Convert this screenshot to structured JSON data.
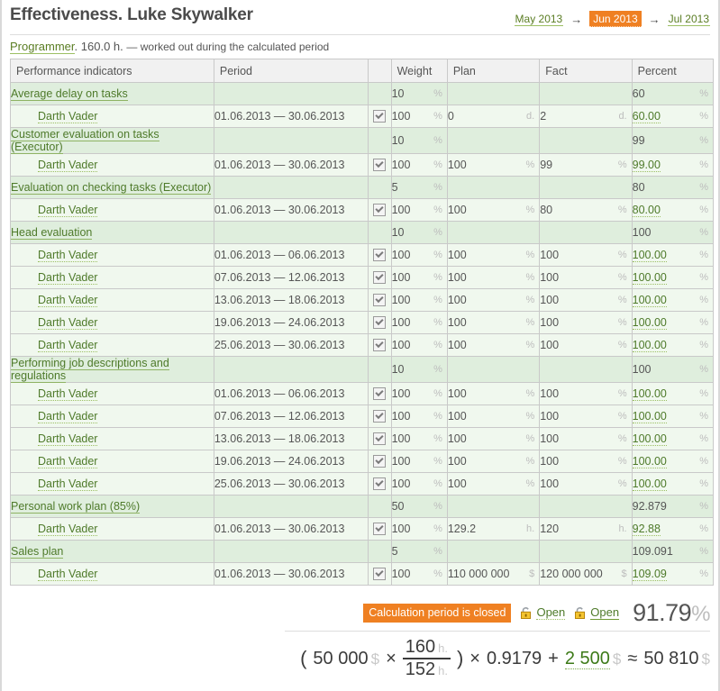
{
  "header": {
    "title": "Effectiveness. Luke Skywalker",
    "period_nav": [
      {
        "label": "May 2013",
        "current": false
      },
      {
        "label": "Jun 2013",
        "current": true
      },
      {
        "label": "Jul 2013",
        "current": false
      }
    ],
    "arrow": "→"
  },
  "subtitle": {
    "role": "Programmer",
    "role_suffix": ".",
    "hours": "160.0 h.",
    "note": "— worked out during the calculated period"
  },
  "table": {
    "columns": [
      "Performance indicators",
      "Period",
      "",
      "Weight",
      "Plan",
      "Fact",
      "Percent"
    ],
    "rows": [
      {
        "type": "group",
        "indicator": "Average delay on tasks",
        "period": "",
        "weight": "10",
        "weight_unit": "%",
        "plan": "",
        "plan_unit": "",
        "fact": "",
        "fact_unit": "",
        "percent": "60",
        "percent_unit": "%"
      },
      {
        "type": "item",
        "indicator": "Darth Vader",
        "period": "01.06.2013 — 30.06.2013",
        "checked": true,
        "weight": "100",
        "weight_unit": "%",
        "plan": "0",
        "plan_unit": "d.",
        "fact": "2",
        "fact_unit": "d.",
        "percent": "60.00",
        "percent_unit": "%"
      },
      {
        "type": "group",
        "indicator": "Customer evaluation on tasks (Executor)",
        "period": "",
        "weight": "10",
        "weight_unit": "%",
        "plan": "",
        "plan_unit": "",
        "fact": "",
        "fact_unit": "",
        "percent": "99",
        "percent_unit": "%"
      },
      {
        "type": "item",
        "indicator": "Darth Vader",
        "period": "01.06.2013 — 30.06.2013",
        "checked": true,
        "weight": "100",
        "weight_unit": "%",
        "plan": "100",
        "plan_unit": "%",
        "fact": "99",
        "fact_unit": "%",
        "percent": "99.00",
        "percent_unit": "%"
      },
      {
        "type": "group",
        "indicator": "Evaluation on checking tasks (Executor)",
        "period": "",
        "weight": "5",
        "weight_unit": "%",
        "plan": "",
        "plan_unit": "",
        "fact": "",
        "fact_unit": "",
        "percent": "80",
        "percent_unit": "%"
      },
      {
        "type": "item",
        "indicator": "Darth Vader",
        "period": "01.06.2013 — 30.06.2013",
        "checked": true,
        "weight": "100",
        "weight_unit": "%",
        "plan": "100",
        "plan_unit": "%",
        "fact": "80",
        "fact_unit": "%",
        "percent": "80.00",
        "percent_unit": "%"
      },
      {
        "type": "group",
        "indicator": "Head evaluation",
        "period": "",
        "weight": "10",
        "weight_unit": "%",
        "plan": "",
        "plan_unit": "",
        "fact": "",
        "fact_unit": "",
        "percent": "100",
        "percent_unit": "%"
      },
      {
        "type": "item",
        "indicator": "Darth Vader",
        "period": "01.06.2013 — 06.06.2013",
        "checked": true,
        "weight": "100",
        "weight_unit": "%",
        "plan": "100",
        "plan_unit": "%",
        "fact": "100",
        "fact_unit": "%",
        "percent": "100.00",
        "percent_unit": "%"
      },
      {
        "type": "item",
        "indicator": "Darth Vader",
        "period": "07.06.2013 — 12.06.2013",
        "checked": true,
        "weight": "100",
        "weight_unit": "%",
        "plan": "100",
        "plan_unit": "%",
        "fact": "100",
        "fact_unit": "%",
        "percent": "100.00",
        "percent_unit": "%"
      },
      {
        "type": "item",
        "indicator": "Darth Vader",
        "period": "13.06.2013 — 18.06.2013",
        "checked": true,
        "weight": "100",
        "weight_unit": "%",
        "plan": "100",
        "plan_unit": "%",
        "fact": "100",
        "fact_unit": "%",
        "percent": "100.00",
        "percent_unit": "%"
      },
      {
        "type": "item",
        "indicator": "Darth Vader",
        "period": "19.06.2013 — 24.06.2013",
        "checked": true,
        "weight": "100",
        "weight_unit": "%",
        "plan": "100",
        "plan_unit": "%",
        "fact": "100",
        "fact_unit": "%",
        "percent": "100.00",
        "percent_unit": "%"
      },
      {
        "type": "item",
        "indicator": "Darth Vader",
        "period": "25.06.2013 — 30.06.2013",
        "checked": true,
        "weight": "100",
        "weight_unit": "%",
        "plan": "100",
        "plan_unit": "%",
        "fact": "100",
        "fact_unit": "%",
        "percent": "100.00",
        "percent_unit": "%"
      },
      {
        "type": "group",
        "indicator": "Performing job descriptions and regulations",
        "period": "",
        "weight": "10",
        "weight_unit": "%",
        "plan": "",
        "plan_unit": "",
        "fact": "",
        "fact_unit": "",
        "percent": "100",
        "percent_unit": "%"
      },
      {
        "type": "item",
        "indicator": "Darth Vader",
        "period": "01.06.2013 — 06.06.2013",
        "checked": true,
        "weight": "100",
        "weight_unit": "%",
        "plan": "100",
        "plan_unit": "%",
        "fact": "100",
        "fact_unit": "%",
        "percent": "100.00",
        "percent_unit": "%"
      },
      {
        "type": "item",
        "indicator": "Darth Vader",
        "period": "07.06.2013 — 12.06.2013",
        "checked": true,
        "weight": "100",
        "weight_unit": "%",
        "plan": "100",
        "plan_unit": "%",
        "fact": "100",
        "fact_unit": "%",
        "percent": "100.00",
        "percent_unit": "%"
      },
      {
        "type": "item",
        "indicator": "Darth Vader",
        "period": "13.06.2013 — 18.06.2013",
        "checked": true,
        "weight": "100",
        "weight_unit": "%",
        "plan": "100",
        "plan_unit": "%",
        "fact": "100",
        "fact_unit": "%",
        "percent": "100.00",
        "percent_unit": "%"
      },
      {
        "type": "item",
        "indicator": "Darth Vader",
        "period": "19.06.2013 — 24.06.2013",
        "checked": true,
        "weight": "100",
        "weight_unit": "%",
        "plan": "100",
        "plan_unit": "%",
        "fact": "100",
        "fact_unit": "%",
        "percent": "100.00",
        "percent_unit": "%"
      },
      {
        "type": "item",
        "indicator": "Darth Vader",
        "period": "25.06.2013 — 30.06.2013",
        "checked": true,
        "weight": "100",
        "weight_unit": "%",
        "plan": "100",
        "plan_unit": "%",
        "fact": "100",
        "fact_unit": "%",
        "percent": "100.00",
        "percent_unit": "%"
      },
      {
        "type": "group",
        "indicator": "Personal work plan (85%)",
        "period": "",
        "weight": "50",
        "weight_unit": "%",
        "plan": "",
        "plan_unit": "",
        "fact": "",
        "fact_unit": "",
        "percent": "92.879",
        "percent_unit": "%"
      },
      {
        "type": "item",
        "indicator": "Darth Vader",
        "period": "01.06.2013 — 30.06.2013",
        "checked": true,
        "weight": "100",
        "weight_unit": "%",
        "plan": "129.2",
        "plan_unit": "h.",
        "fact": "120",
        "fact_unit": "h.",
        "percent": "92.88",
        "percent_unit": "%"
      },
      {
        "type": "group",
        "indicator": "Sales plan",
        "period": "",
        "weight": "5",
        "weight_unit": "%",
        "plan": "",
        "plan_unit": "",
        "fact": "",
        "fact_unit": "",
        "percent": "109.091",
        "percent_unit": "%"
      },
      {
        "type": "item",
        "indicator": "Darth Vader",
        "period": "01.06.2013 — 30.06.2013",
        "checked": true,
        "weight": "100",
        "weight_unit": "%",
        "plan": "110 000 000",
        "plan_unit": "$",
        "fact": "120 000 000",
        "fact_unit": "$",
        "percent": "109.09",
        "percent_unit": "%"
      }
    ]
  },
  "footer": {
    "closed_badge": "Calculation period is closed",
    "open_links": [
      {
        "label": "Open",
        "style": "dotted"
      },
      {
        "label": "Open",
        "style": "solid"
      }
    ],
    "total_percent": "91.79",
    "total_percent_sign": "%",
    "formula": {
      "open_paren": "(",
      "salary": "50 000",
      "salary_unit": "$",
      "times1": "×",
      "fraction_numerator": "160",
      "fraction_numerator_unit": "h.",
      "fraction_denominator": "152",
      "fraction_denominator_unit": "h.",
      "close_paren": ")",
      "times2": "×",
      "coefficient": "0.9179",
      "plus": "+",
      "bonus": "2 500",
      "bonus_unit": "$",
      "approx": "≈",
      "result": "50 810",
      "result_unit": "$"
    }
  }
}
